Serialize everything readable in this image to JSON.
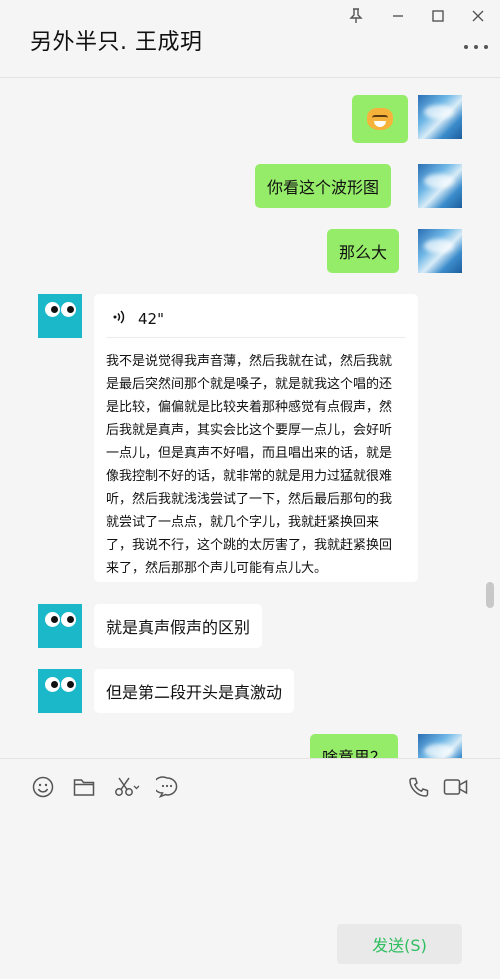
{
  "window": {
    "title": "另外半只. 王成玥",
    "controls": {
      "pin": "pin-icon",
      "minimize": "minimize-icon",
      "maximize": "maximize-icon",
      "close": "close-icon"
    }
  },
  "messages": [
    {
      "side": "self",
      "type": "emoji",
      "icon": "doge-emoji"
    },
    {
      "side": "self",
      "type": "text",
      "text": "你看这个波形图"
    },
    {
      "side": "self",
      "type": "text",
      "text": "那么大"
    },
    {
      "side": "other",
      "type": "voice",
      "duration": "42\"",
      "transcript": "我不是说觉得我声音薄，然后我就在试，然后我就是最后突然间那个就是嗓子，就是就我这个唱的还是比较，偏偏就是比较夹着那种感觉有点假声，然后我就是真声，其实会比这个要厚一点儿，会好听一点儿，但是真声不好唱，而且唱出来的话，就是像我控制不好的话，就非常的就是用力过猛就很难听，然后我就浅浅尝试了一下，然后最后那句的我就尝试了一点点，就几个字儿，我就赶紧换回来了，我说不行，这个跳的太厉害了，我就赶紧换回来了，然后那那个声儿可能有点儿大。"
    },
    {
      "side": "other",
      "type": "text",
      "text": "就是真声假声的区别"
    },
    {
      "side": "other",
      "type": "text",
      "text": "但是第二段开头是真激动"
    },
    {
      "side": "self",
      "type": "text",
      "text": "啥意思？"
    }
  ],
  "toolbar": {
    "left": [
      "emoji-icon",
      "folder-icon",
      "scissors-icon",
      "chat-bubble-icon"
    ],
    "right": [
      "phone-icon",
      "video-icon"
    ]
  },
  "composer": {
    "send_label": "发送(S)"
  },
  "colors": {
    "self_bubble": "#95ec69",
    "other_bubble": "#ffffff",
    "background": "#f5f5f5",
    "send_text": "#2dbe60"
  }
}
